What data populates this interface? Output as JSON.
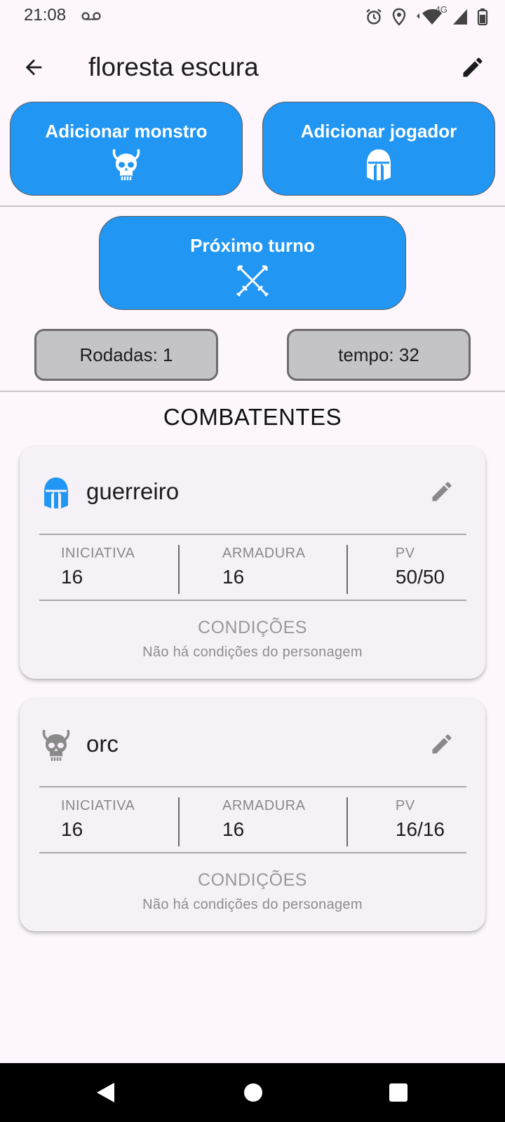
{
  "status_bar": {
    "time": "21:08",
    "network": "4G"
  },
  "app_bar": {
    "title": "floresta escura"
  },
  "actions": {
    "add_monster": "Adicionar monstro",
    "add_player": "Adicionar jogador",
    "next_turn": "Próximo turno"
  },
  "counters": {
    "rounds": "Rodadas: 1",
    "time": "tempo: 32"
  },
  "section_title": "COMBATENTES",
  "combatants": [
    {
      "name": "guerreiro",
      "icon": "helmet-icon",
      "initiative_label": "INICIATIVA",
      "initiative": "16",
      "armor_label": "ARMADURA",
      "armor": "16",
      "hp_label": "PV",
      "hp": "50/50",
      "conditions_title": "CONDIÇÕES",
      "conditions_text": "Não há condições do personagem"
    },
    {
      "name": "orc",
      "icon": "skull-icon",
      "initiative_label": "INICIATIVA",
      "initiative": "16",
      "armor_label": "ARMADURA",
      "armor": "16",
      "hp_label": "PV",
      "hp": "16/16",
      "conditions_title": "CONDIÇÕES",
      "conditions_text": "Não há condições do personagem"
    }
  ],
  "colors": {
    "background": "#fdf7fd",
    "accent": "#2196f3",
    "player_icon": "#2196f3",
    "monster_icon": "#8a8a8a",
    "counter_bg": "#c4c3c6"
  }
}
